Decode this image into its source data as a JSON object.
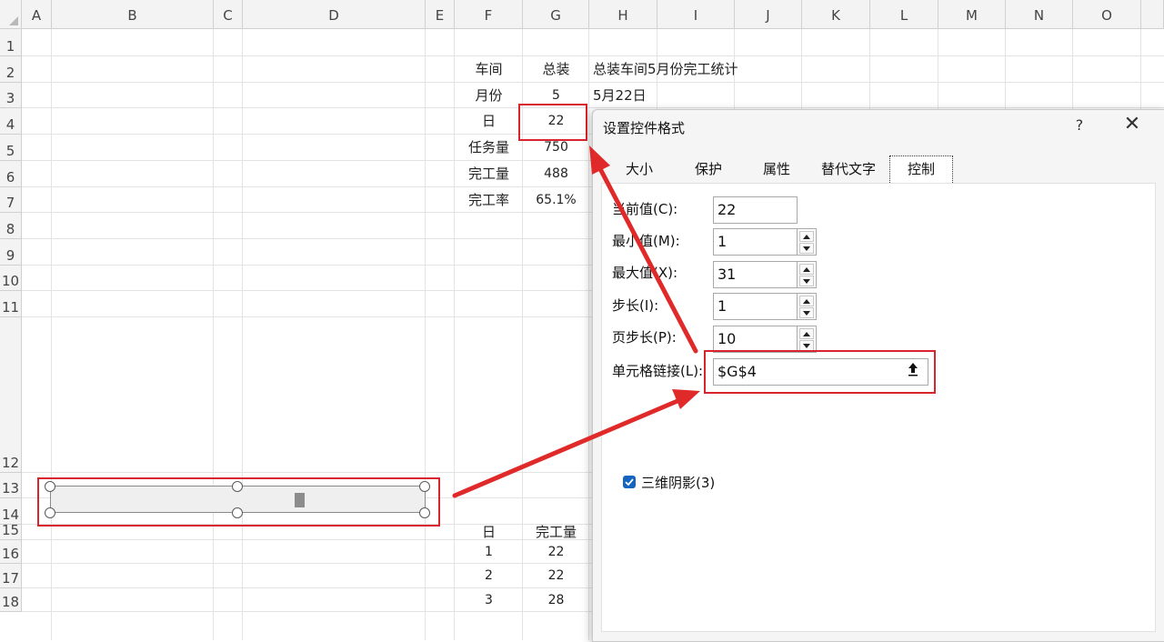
{
  "columns": [
    "A",
    "B",
    "C",
    "D",
    "E",
    "F",
    "G",
    "H",
    "I",
    "J",
    "K",
    "L",
    "M",
    "N",
    "O"
  ],
  "rows": [
    "1",
    "2",
    "3",
    "4",
    "5",
    "6",
    "7",
    "8",
    "9",
    "10",
    "11",
    "12",
    "13",
    "14",
    "15",
    "16",
    "17",
    "18"
  ],
  "cells": {
    "F2": "车间",
    "G2": "总装",
    "H2": "总装车间5月份完工统计",
    "F3": "月份",
    "G3": "5",
    "H3": "5月22日",
    "F4": "日",
    "G4": "22",
    "F5": "任务量",
    "G5": "750",
    "F6": "完工量",
    "G6": "488",
    "F7": "完工率",
    "G7": "65.1%",
    "F15": "日",
    "G15": "完工量",
    "F16": "1",
    "G16": "22",
    "F17": "2",
    "G17": "22",
    "F18": "3",
    "G18": "28"
  },
  "dialog": {
    "title": "设置控件格式",
    "help": "?",
    "close": "✕",
    "tabs": [
      "大小",
      "保护",
      "属性",
      "替代文字",
      "控制"
    ],
    "active_tab": "控制",
    "fields": {
      "current_label": "当前值(C):",
      "current_value": "22",
      "min_label": "最小值(M):",
      "min_value": "1",
      "max_label": "最大值(X):",
      "max_value": "31",
      "step_label": "步长(I):",
      "step_value": "1",
      "page_label": "页步长(P):",
      "page_value": "10",
      "link_label": "单元格链接(L):",
      "link_value": "$G$4"
    },
    "shading_label": "三维阴影(3)",
    "shading_checked": true
  },
  "colors": {
    "highlight": "#d9232d",
    "checkbox": "#1565c0"
  }
}
